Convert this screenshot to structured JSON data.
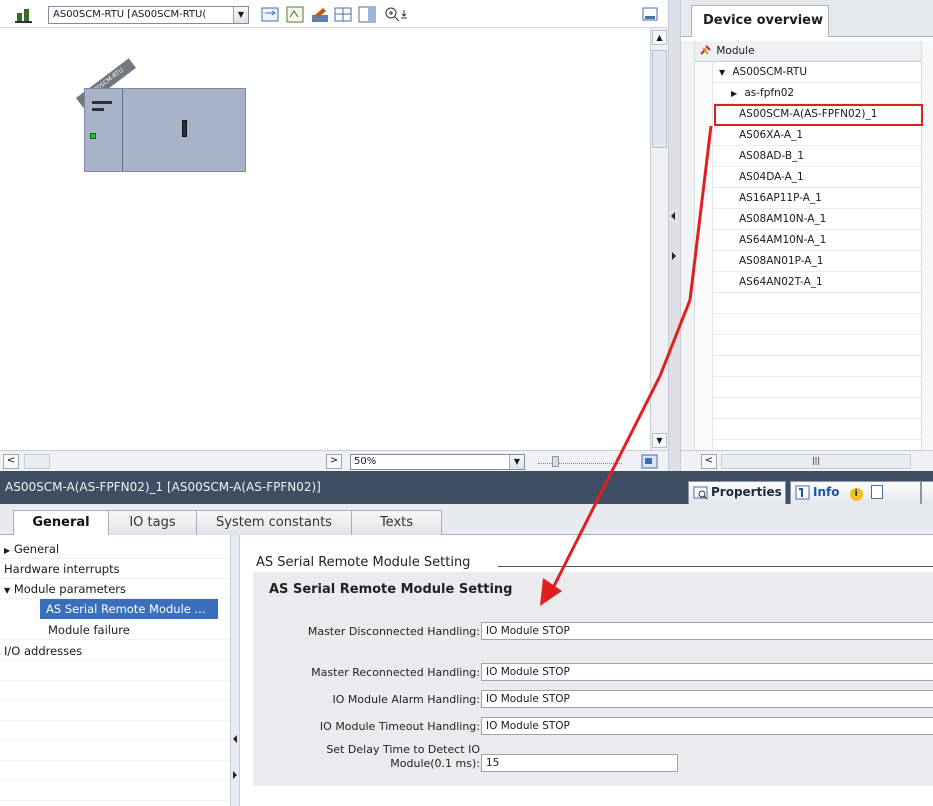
{
  "device_view": {
    "device_select": "AS00SCM-RTU [AS00SCM-RTU(",
    "rack_label": "AS00SCM-RTU",
    "zoom_level": "50%"
  },
  "device_overview": {
    "tab_label": "Device overview",
    "header": "Module",
    "rows": [
      {
        "name": "AS00SCM-RTU"
      },
      {
        "name": "as-fpfn02"
      },
      {
        "name": "AS00SCM-A(AS-FPFN02)_1"
      },
      {
        "name": "AS06XA-A_1"
      },
      {
        "name": "AS08AD-B_1"
      },
      {
        "name": "AS04DA-A_1"
      },
      {
        "name": "AS16AP11P-A_1"
      },
      {
        "name": "AS08AM10N-A_1"
      },
      {
        "name": "AS64AM10N-A_1"
      },
      {
        "name": "AS08AN01P-A_1"
      },
      {
        "name": "AS64AN02T-A_1"
      }
    ]
  },
  "properties": {
    "title": "AS00SCM-A(AS-FPFN02)_1 [AS00SCM-A(AS-FPFN02)]",
    "tabs": {
      "properties": "Properties",
      "info": "Info",
      "diagnostics": "D"
    }
  },
  "general_tabs": [
    "General",
    "IO tags",
    "System constants",
    "Texts"
  ],
  "nav": {
    "items": [
      {
        "label": "General",
        "arrow": "▶"
      },
      {
        "label": "Hardware interrupts",
        "arrow": ""
      },
      {
        "label": "Module parameters",
        "arrow": "▼"
      },
      {
        "label": "AS Serial Remote Module ...",
        "arrow": ""
      },
      {
        "label": "Module failure",
        "arrow": ""
      },
      {
        "label": "I/O addresses",
        "arrow": ""
      }
    ]
  },
  "content": {
    "section_title": "AS Serial Remote Module Setting",
    "group_title": "AS Serial Remote Module Setting",
    "fields": [
      {
        "label": "Master Disconnected Handling:",
        "value": "IO Module STOP"
      },
      {
        "label": "Master Reconnected Handling:",
        "value": "IO Module STOP"
      },
      {
        "label": "IO Module Alarm Handling:",
        "value": "IO Module STOP"
      },
      {
        "label": "IO Module Timeout Handling:",
        "value": "IO Module STOP"
      },
      {
        "label_line1": "Set Delay Time to Detect IO",
        "label_line2": "Module(0.1 ms):",
        "value": "15"
      }
    ]
  },
  "colors": {
    "annotation": "#e02020",
    "title_bar": "#3e4e63",
    "selection": "#3a6fbd"
  }
}
